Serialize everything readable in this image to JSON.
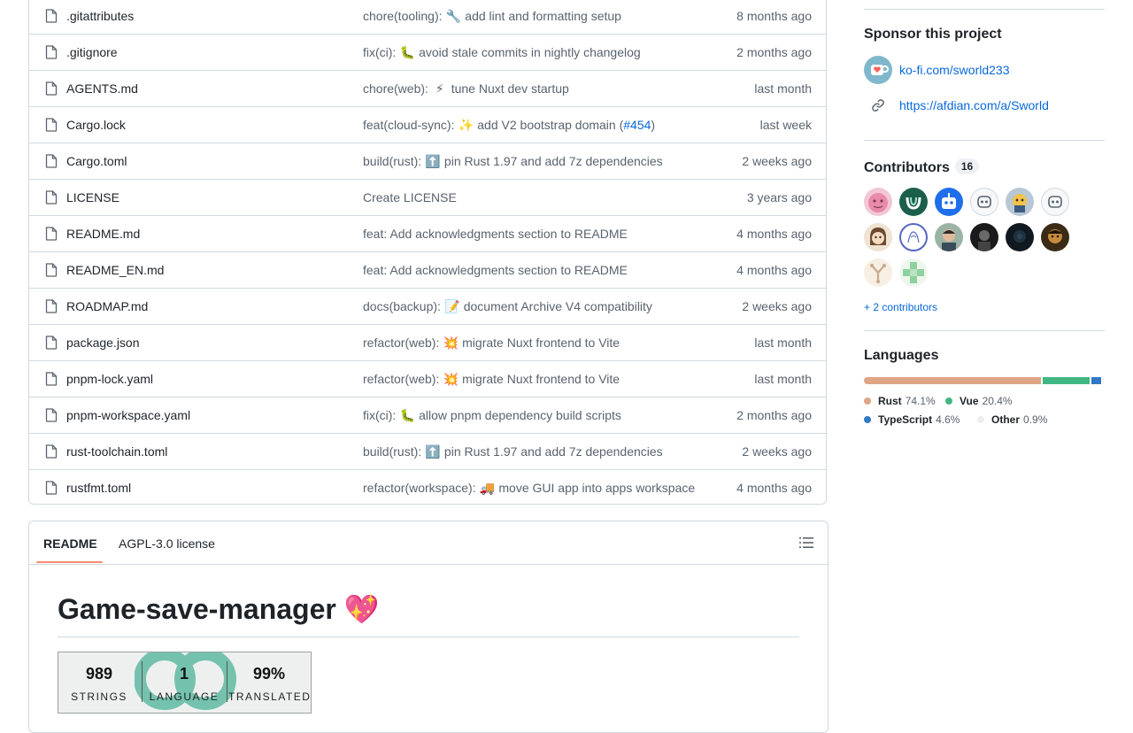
{
  "files": [
    {
      "name": ".gitattributes",
      "msg_pre": "chore(tooling): ",
      "emoji": "🔧",
      "msg_post": " add lint and formatting setup",
      "date": "8 months ago"
    },
    {
      "name": ".gitignore",
      "msg_pre": "fix(ci): ",
      "emoji": "🐛",
      "msg_post": " avoid stale commits in nightly changelog",
      "date": "2 months ago"
    },
    {
      "name": "AGENTS.md",
      "msg_pre": "chore(web): ",
      "emoji": "⚡",
      "msg_post": " tune Nuxt dev startup",
      "date": "last month"
    },
    {
      "name": "Cargo.lock",
      "msg_pre": "feat(cloud-sync): ",
      "emoji": "✨",
      "msg_post": " add V2 bootstrap domain (",
      "pr": "#454",
      "msg_tail": ")",
      "date": "last week"
    },
    {
      "name": "Cargo.toml",
      "msg_pre": "build(rust): ",
      "emoji": "⬆️",
      "msg_post": " pin Rust 1.97 and add 7z dependencies",
      "date": "2 weeks ago"
    },
    {
      "name": "LICENSE",
      "msg_pre": "Create LICENSE",
      "emoji": "",
      "msg_post": "",
      "date": "3 years ago"
    },
    {
      "name": "README.md",
      "msg_pre": "feat: Add acknowledgments section to README",
      "emoji": "",
      "msg_post": "",
      "date": "4 months ago"
    },
    {
      "name": "README_EN.md",
      "msg_pre": "feat: Add acknowledgments section to README",
      "emoji": "",
      "msg_post": "",
      "date": "4 months ago"
    },
    {
      "name": "ROADMAP.md",
      "msg_pre": "docs(backup): ",
      "emoji": "📝",
      "msg_post": " document Archive V4 compatibility",
      "date": "2 weeks ago"
    },
    {
      "name": "package.json",
      "msg_pre": "refactor(web): ",
      "emoji": "💥",
      "msg_post": " migrate Nuxt frontend to Vite",
      "date": "last month"
    },
    {
      "name": "pnpm-lock.yaml",
      "msg_pre": "refactor(web): ",
      "emoji": "💥",
      "msg_post": " migrate Nuxt frontend to Vite",
      "date": "last month"
    },
    {
      "name": "pnpm-workspace.yaml",
      "msg_pre": "fix(ci): ",
      "emoji": "🐛",
      "msg_post": " allow pnpm dependency build scripts",
      "date": "2 months ago"
    },
    {
      "name": "rust-toolchain.toml",
      "msg_pre": "build(rust): ",
      "emoji": "⬆️",
      "msg_post": " pin Rust 1.97 and add 7z dependencies",
      "date": "2 weeks ago"
    },
    {
      "name": "rustfmt.toml",
      "msg_pre": "refactor(workspace): ",
      "emoji": "🚚",
      "msg_post": " move GUI app into apps workspace",
      "date": "4 months ago"
    }
  ],
  "readme": {
    "tabs": [
      "README",
      "AGPL-3.0 license"
    ],
    "title": "Game-save-manager 💖",
    "badge": {
      "strings_value": "989",
      "strings_label": "STRINGS",
      "language_value": "1",
      "language_label": "LANGUAGE",
      "translated_value": "99%",
      "translated_label": "TRANSLATED"
    }
  },
  "sidebar": {
    "sponsor_heading": "Sponsor this project",
    "sponsor_links": [
      "ko-fi.com/sworld233",
      "https://afdian.com/a/Sworld"
    ],
    "contributors_heading": "Contributors",
    "contributors_count": "16",
    "more_contributors": "+ 2 contributors",
    "languages_heading": "Languages",
    "languages": [
      {
        "name": "Rust",
        "percent": "74.1%",
        "share": 74.1,
        "color": "#dea584"
      },
      {
        "name": "Vue",
        "percent": "20.4%",
        "share": 20.4,
        "color": "#41b883"
      },
      {
        "name": "TypeScript",
        "percent": "4.6%",
        "share": 4.6,
        "color": "#3178c6"
      },
      {
        "name": "Other",
        "percent": "0.9%",
        "share": 0.9,
        "color": "#ededed"
      }
    ]
  }
}
